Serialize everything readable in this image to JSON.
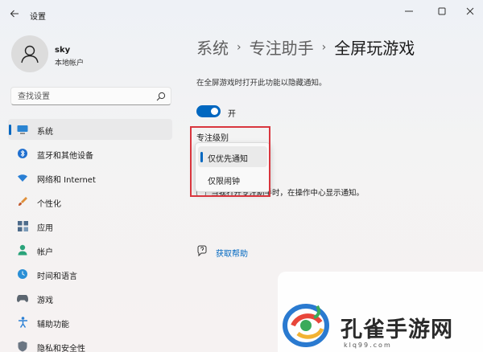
{
  "window": {
    "title": "设置"
  },
  "profile": {
    "name": "sky",
    "account_type": "本地帐户"
  },
  "search": {
    "placeholder": "查找设置"
  },
  "sidebar": {
    "items": [
      {
        "label": "系统",
        "icon": "monitor-icon",
        "active": true
      },
      {
        "label": "蓝牙和其他设备",
        "icon": "bluetooth-icon"
      },
      {
        "label": "网络和 Internet",
        "icon": "wifi-icon"
      },
      {
        "label": "个性化",
        "icon": "brush-icon"
      },
      {
        "label": "应用",
        "icon": "apps-icon"
      },
      {
        "label": "帐户",
        "icon": "account-icon"
      },
      {
        "label": "时间和语言",
        "icon": "clock-icon"
      },
      {
        "label": "游戏",
        "icon": "gamepad-icon"
      },
      {
        "label": "辅助功能",
        "icon": "accessibility-icon"
      },
      {
        "label": "隐私和安全性",
        "icon": "shield-icon"
      }
    ]
  },
  "breadcrumb": {
    "items": [
      "系统",
      "专注助手"
    ],
    "current": "全屏玩游戏",
    "separator": "›"
  },
  "main": {
    "description": "在全屏游戏时打开此功能以隐藏通知。",
    "toggle_label": "开",
    "toggle_on": true,
    "focus_level_label": "专注级别",
    "checkbox_label": "当我打开专注助手时，在操作中心显示通知。",
    "help_link": "获取帮助"
  },
  "dropdown": {
    "options": [
      "仅优先通知",
      "仅限闹钟"
    ],
    "selected_index": 0
  },
  "watermark": {
    "text": "孔雀手游网",
    "url": "klq99.com"
  },
  "colors": {
    "accent": "#0067c0",
    "highlight": "#d9363e"
  }
}
